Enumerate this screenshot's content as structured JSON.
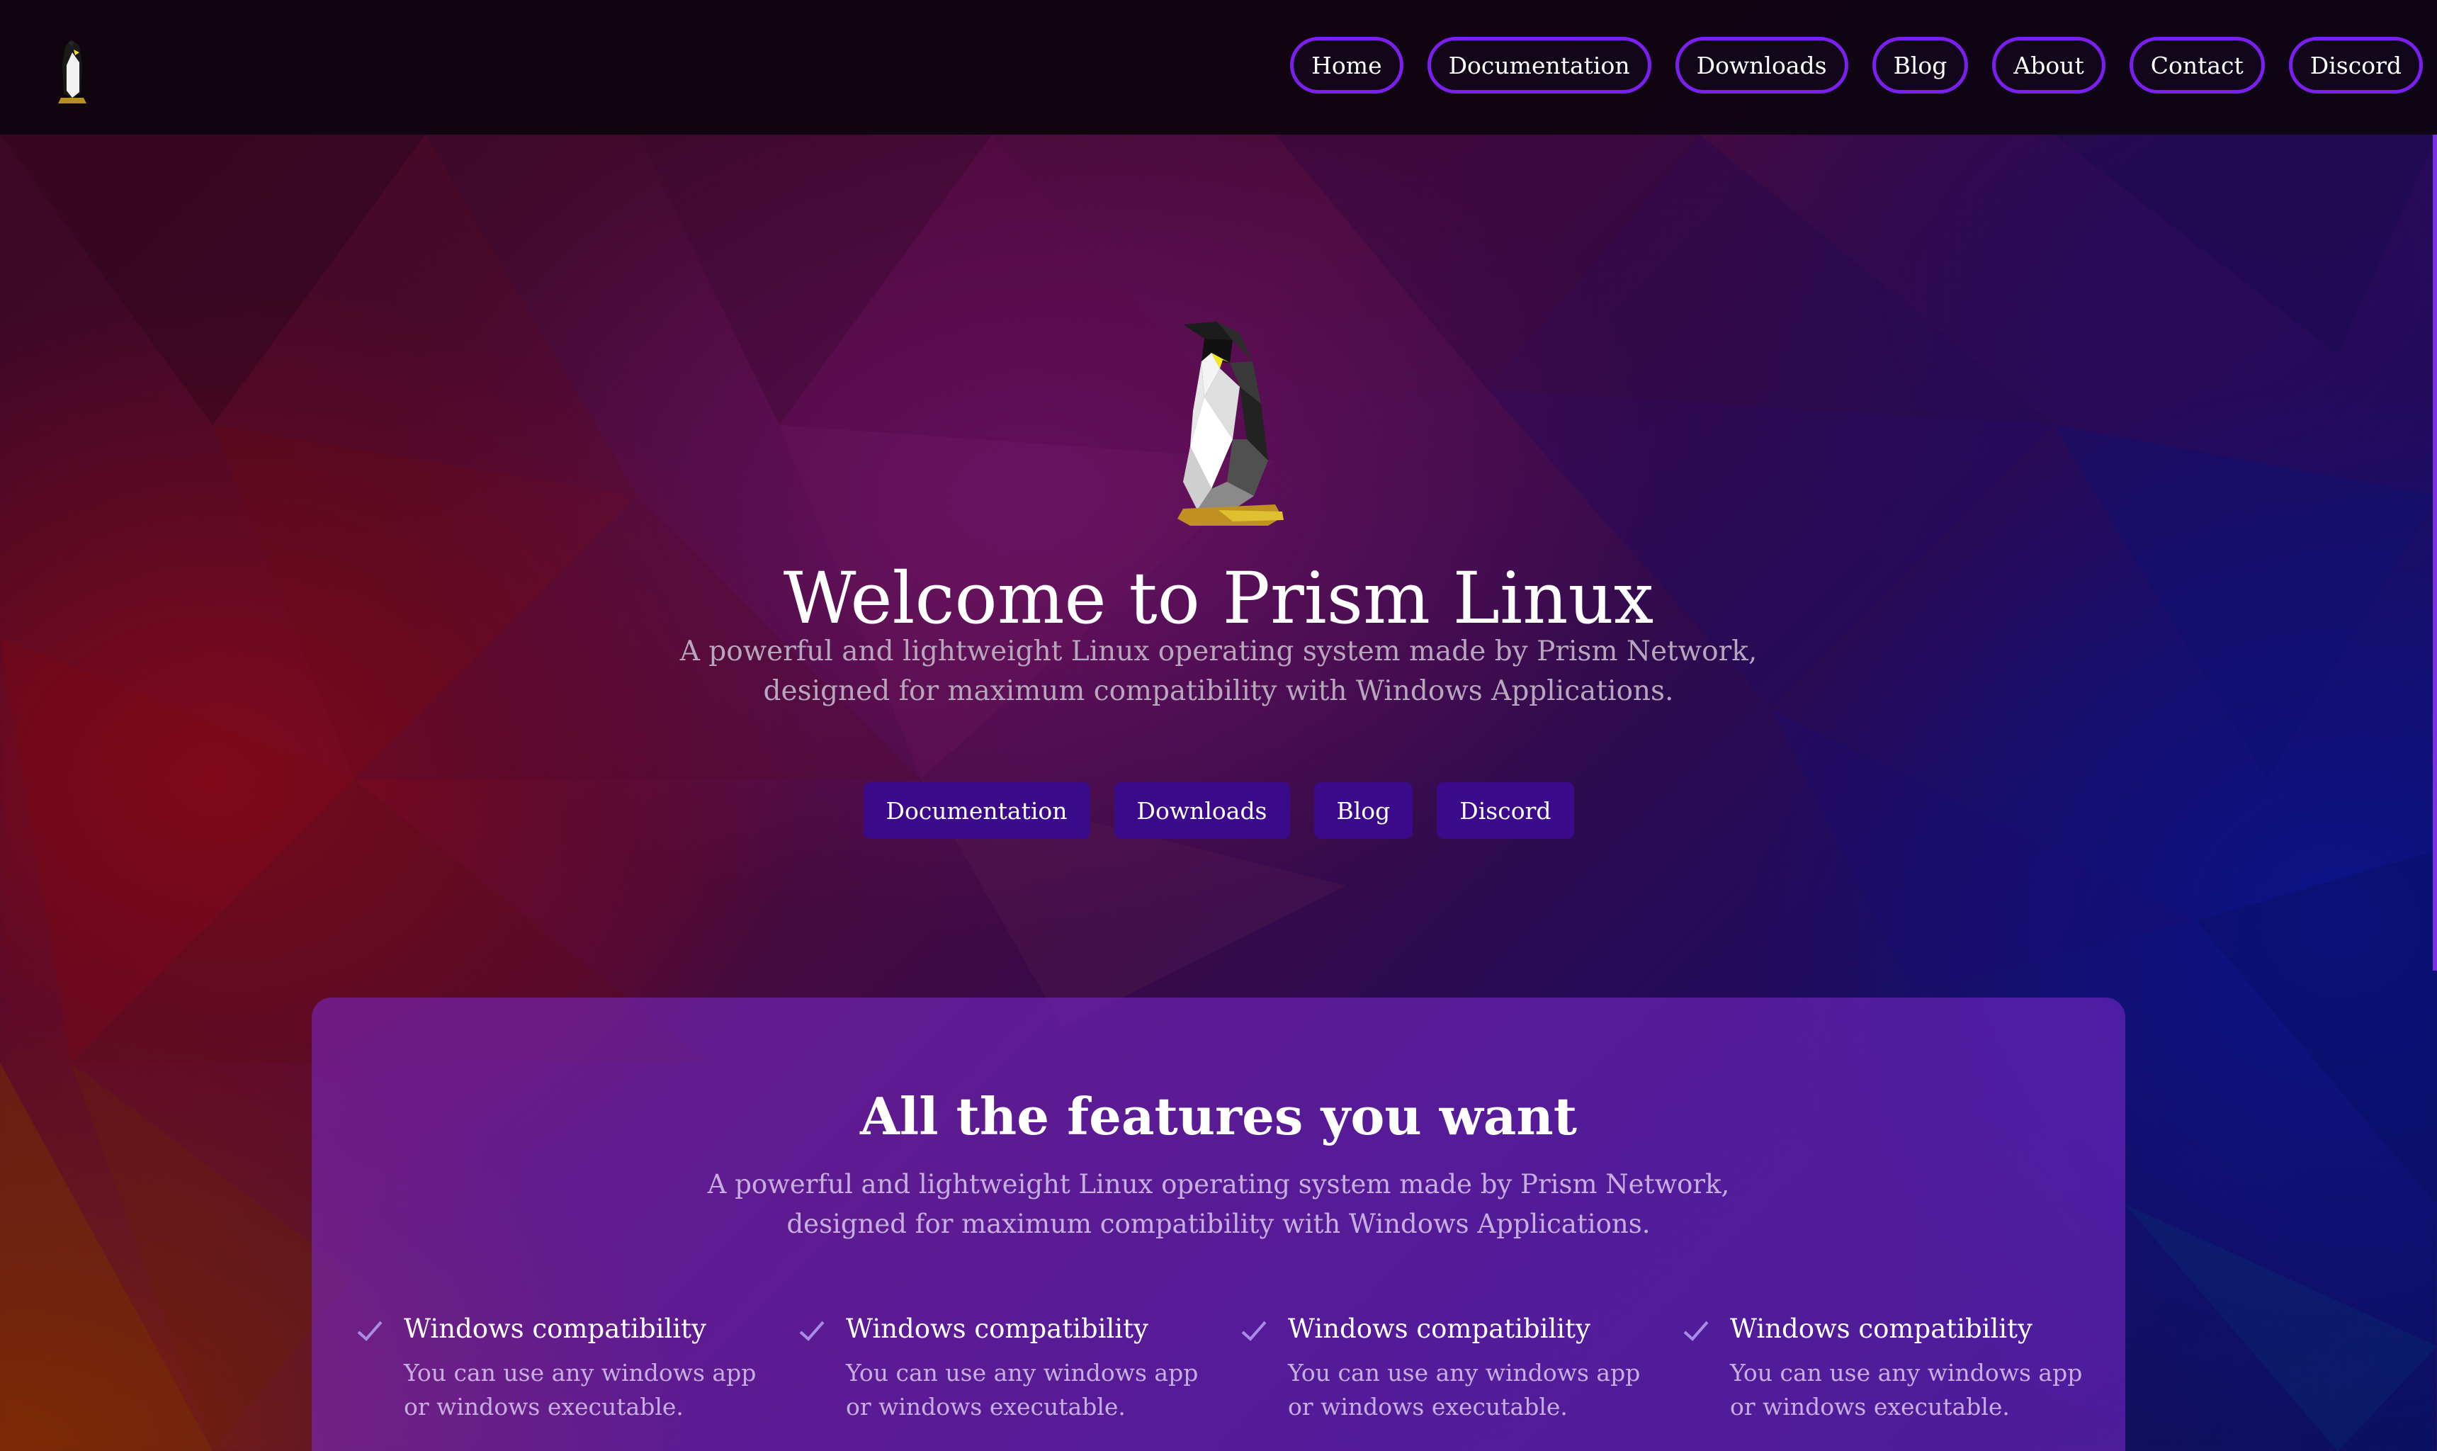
{
  "nav": {
    "links": [
      "Home",
      "Documentation",
      "Downloads",
      "Blog",
      "About",
      "Contact",
      "Discord"
    ]
  },
  "hero": {
    "title": "Welcome to Prism Linux",
    "subtitle_line1": "A powerful and lightweight Linux operating system made by Prism Network,",
    "subtitle_line2": "designed for maximum compatibility with Windows Applications.",
    "buttons": [
      "Documentation",
      "Downloads",
      "Blog",
      "Discord"
    ]
  },
  "features": {
    "title": "All the features you want",
    "subtitle_line1": "A powerful and lightweight Linux operating system made by Prism Network,",
    "subtitle_line2": "designed for maximum compatibility with Windows Applications.",
    "items": [
      {
        "title": "Windows compatibility",
        "desc": "You can use any windows app or windows executable."
      },
      {
        "title": "Windows compatibility",
        "desc": "You can use any windows app or windows executable."
      },
      {
        "title": "Windows compatibility",
        "desc": "You can use any windows app or windows executable."
      },
      {
        "title": "Windows compatibility",
        "desc": "You can use any windows app or windows executable."
      }
    ]
  },
  "icons": {
    "logo": "penguin-icon",
    "feature_check": "check-icon"
  },
  "colors": {
    "accent": "#7a1ff0",
    "button_bg": "#3a0a8a",
    "feature_panel": "#7828c8"
  }
}
